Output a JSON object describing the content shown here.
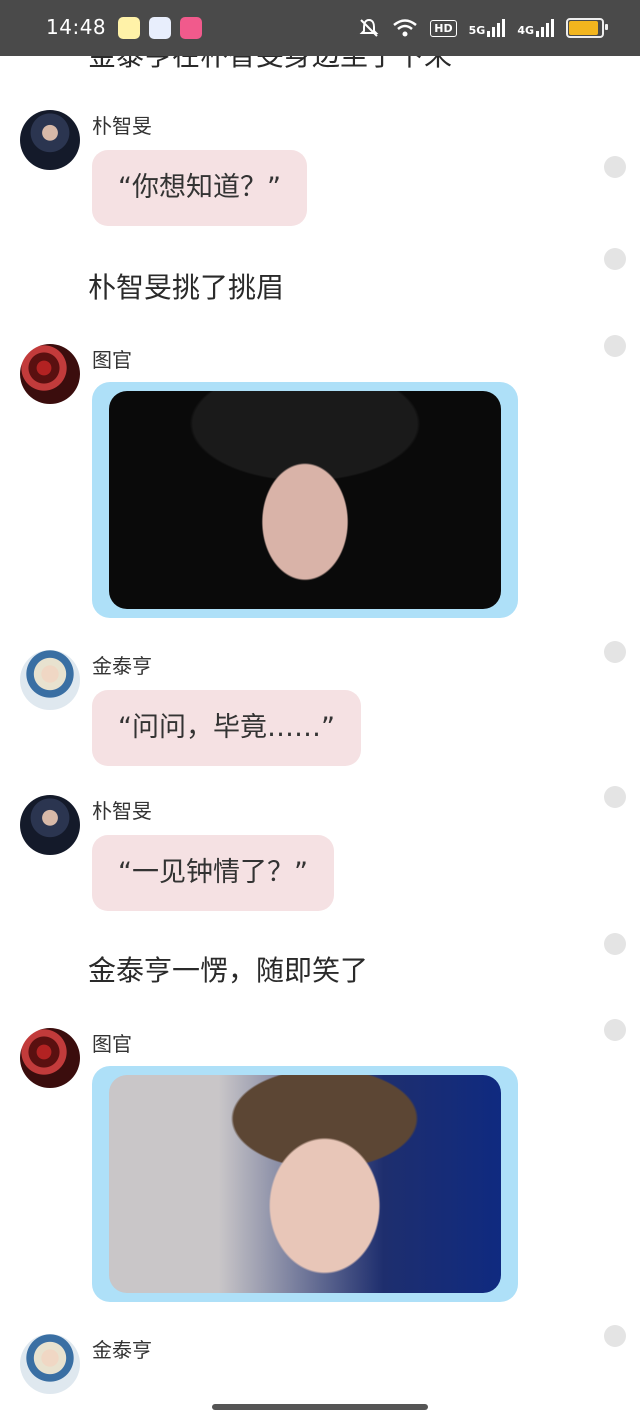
{
  "status_bar": {
    "time": "14:48",
    "network_hd": "HD",
    "network_5g": "5G",
    "network_4g": "4G",
    "app_icons": [
      "bell-app-icon",
      "baidu-paw-icon",
      "pink-app-icon"
    ],
    "battery_level": 0.85,
    "battery_color": "#f2b51e"
  },
  "chat": {
    "top_cut_text": "金泰亨在朴智旻身边坐了下来",
    "messages": [
      {
        "type": "speech",
        "speaker": "朴智旻",
        "text": "“你想知道？”"
      },
      {
        "type": "narration",
        "text": "朴智旻挑了挑眉"
      },
      {
        "type": "image",
        "speaker": "图官"
      },
      {
        "type": "speech",
        "speaker": "金泰亨",
        "text": "“问问，毕竟……”"
      },
      {
        "type": "speech",
        "speaker": "朴智旻",
        "text": "“一见钟情了？”"
      },
      {
        "type": "narration",
        "text": "金泰亨一愣，随即笑了"
      },
      {
        "type": "image",
        "speaker": "图官"
      },
      {
        "type": "speech",
        "speaker": "金泰亨",
        "text": ""
      }
    ]
  },
  "colors": {
    "bubble": "#f5e1e3",
    "image_frame": "#aee0f8",
    "status_bar": "#4a4a4a"
  }
}
